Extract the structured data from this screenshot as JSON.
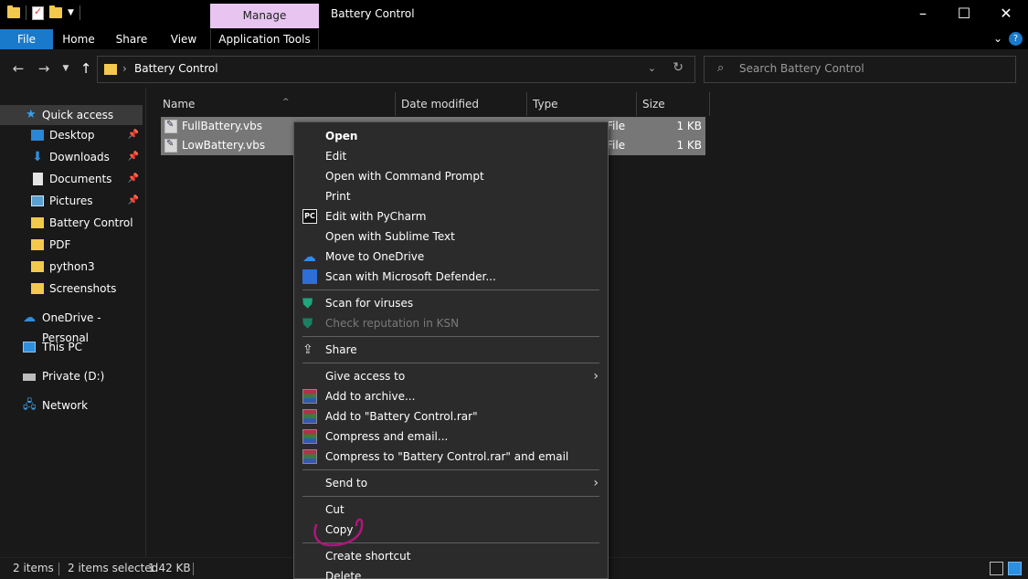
{
  "window": {
    "title": "Battery Control",
    "contextual_tab": "Manage",
    "minimize_icon": "minimize-icon",
    "maximize_icon": "maximize-icon",
    "close_icon": "close-icon"
  },
  "ribbon": {
    "tabs": [
      "File",
      "Home",
      "Share",
      "View",
      "Application Tools"
    ],
    "file_color": "#1979ca",
    "manage_color": "#e7c5f0"
  },
  "address": {
    "crumb": "Battery Control"
  },
  "search": {
    "placeholder": "Search Battery Control"
  },
  "sidebar": {
    "items": [
      {
        "label": "Quick access",
        "icon": "star-icon",
        "selected": true
      },
      {
        "label": "Desktop",
        "icon": "desktop-icon",
        "pinned": true
      },
      {
        "label": "Downloads",
        "icon": "download-icon",
        "pinned": true
      },
      {
        "label": "Documents",
        "icon": "document-icon",
        "pinned": true
      },
      {
        "label": "Pictures",
        "icon": "pictures-icon",
        "pinned": true
      },
      {
        "label": "Battery Control",
        "icon": "folder-icon"
      },
      {
        "label": "PDF",
        "icon": "folder-icon"
      },
      {
        "label": "python3",
        "icon": "folder-icon"
      },
      {
        "label": "Screenshots",
        "icon": "folder-icon"
      },
      {
        "label": "OneDrive - Personal",
        "icon": "cloud-icon"
      },
      {
        "label": "This PC",
        "icon": "computer-icon"
      },
      {
        "label": "Private (D:)",
        "icon": "drive-icon"
      },
      {
        "label": "Network",
        "icon": "network-icon"
      }
    ]
  },
  "filelist": {
    "columns": [
      "Name",
      "Date modified",
      "Type",
      "Size"
    ],
    "files": [
      {
        "name": "FullBattery.vbs",
        "type": "File",
        "size": "1 KB"
      },
      {
        "name": "LowBattery.vbs",
        "type": "File",
        "size": "1 KB"
      }
    ]
  },
  "context_menu": {
    "items": [
      {
        "label": "Open",
        "bold": true
      },
      {
        "label": "Edit"
      },
      {
        "label": "Open with Command Prompt"
      },
      {
        "label": "Print"
      },
      {
        "label": "Edit with PyCharm",
        "icon": "pycharm-icon"
      },
      {
        "label": "Open with Sublime Text"
      },
      {
        "label": "Move to OneDrive",
        "icon": "onedrive-icon"
      },
      {
        "label": "Scan with Microsoft Defender...",
        "icon": "defender-icon"
      },
      {
        "label": "Scan for viruses",
        "icon": "kaspersky-icon"
      },
      {
        "label": "Check reputation in KSN",
        "icon": "kaspersky-icon",
        "disabled": true
      },
      {
        "label": "Share",
        "icon": "share-icon"
      },
      {
        "label": "Give access to",
        "submenu": true
      },
      {
        "label": "Add to archive...",
        "icon": "winrar-icon"
      },
      {
        "label": "Add to \"Battery Control.rar\"",
        "icon": "winrar-icon"
      },
      {
        "label": "Compress and email...",
        "icon": "winrar-icon"
      },
      {
        "label": "Compress to \"Battery Control.rar\" and email",
        "icon": "winrar-icon"
      },
      {
        "label": "Send to",
        "submenu": true
      },
      {
        "label": "Cut"
      },
      {
        "label": "Copy"
      },
      {
        "label": "Create shortcut"
      },
      {
        "label": "Delete"
      }
    ],
    "annotation_color": "#b0167a"
  },
  "statusbar": {
    "items_count": "2 items",
    "selected": "2 items selected",
    "size": "1.42 KB"
  }
}
